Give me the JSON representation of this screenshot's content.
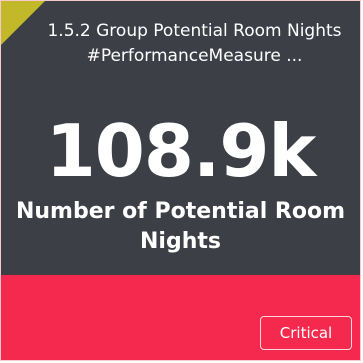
{
  "card": {
    "title": "1.5.2 Group Potential Room Nights #PerformanceMeasure ...",
    "value": "108.9k",
    "label": "Number of Potential Room Nights",
    "status": "Critical"
  },
  "colors": {
    "card_background": "#3d3f47",
    "corner_flag": "#c2b92a",
    "status_band": "#f5294d",
    "text": "#ffffff"
  }
}
